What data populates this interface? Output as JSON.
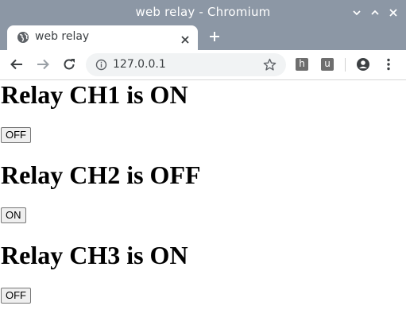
{
  "window": {
    "title": "web relay - Chromium"
  },
  "tab": {
    "title": "web relay"
  },
  "omnibox": {
    "url": "127.0.0.1"
  },
  "extensions": [
    {
      "letter": "h"
    },
    {
      "letter": "u"
    }
  ],
  "relays": [
    {
      "heading": "Relay CH1 is ON",
      "button": "OFF"
    },
    {
      "heading": "Relay CH2 is OFF",
      "button": "ON"
    },
    {
      "heading": "Relay CH3 is ON",
      "button": "OFF"
    }
  ],
  "colors": {
    "titlebar": "#8c97a5",
    "omnibox": "#f1f3f4"
  }
}
